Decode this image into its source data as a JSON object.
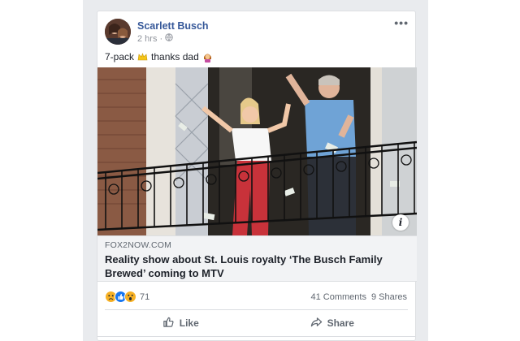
{
  "post": {
    "author": "Scarlett Busch",
    "time": "2 hrs",
    "privacy_icon": "globe-icon",
    "more_label": "•••",
    "caption": "7-pack",
    "caption_suffix": "thanks dad",
    "link": {
      "domain": "FOX2NOW.COM",
      "headline": "Reality show about St. Louis royalty ‘The Busch Family Brewed’ coming to MTV"
    },
    "reactions": {
      "icons": [
        "sad",
        "like",
        "wow"
      ],
      "count": "71"
    },
    "comments": "41 Comments",
    "shares": "9 Shares",
    "actions": {
      "like": "Like",
      "share": "Share"
    },
    "info_label": "i"
  },
  "colors": {
    "link_blue": "#365899",
    "like_blue": "#1877f2",
    "reaction_yellow": "#f7b125",
    "feed_bg": "#e9ebee"
  }
}
